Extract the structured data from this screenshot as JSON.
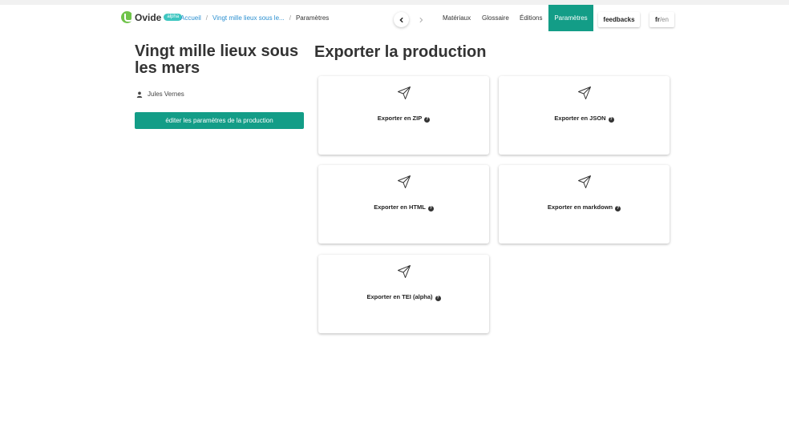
{
  "nav": {
    "logo_text": "Ovide",
    "badge": "alpha",
    "breadcrumb": [
      "Accueil",
      "Vingt mille lieux sous le...",
      "Paramètres"
    ],
    "breadcrumb_sep": "/",
    "menu": [
      "Matériaux",
      "Glossaire",
      "Éditions",
      "Paramètres"
    ],
    "active_menu": "Paramètres",
    "feedbacks": "feedbacks",
    "lang_current": "fr",
    "lang_sep": "/",
    "lang_other": "en"
  },
  "production": {
    "title": "Vingt mille lieux sous les mers",
    "author": "Jules Vernes",
    "edit_button": "éditer les paramètres de la production"
  },
  "export": {
    "heading": "Exporter la production",
    "cards": [
      {
        "label": "Exporter en ZIP",
        "icon": "send-icon",
        "help_icon": "question-circle-icon"
      },
      {
        "label": "Exporter en JSON",
        "icon": "send-icon",
        "help_icon": "question-circle-icon"
      },
      {
        "label": "Exporter en HTML",
        "icon": "send-icon",
        "help_icon": "question-circle-icon"
      },
      {
        "label": "Exporter en markdown",
        "icon": "send-icon",
        "help_icon": "question-circle-icon"
      },
      {
        "label": "Exporter en TEI (alpha)",
        "icon": "send-icon",
        "help_icon": "question-circle-icon"
      }
    ]
  },
  "colors": {
    "accent": "#139d87",
    "link": "#2a8fd0",
    "logo": "#6fc34a"
  }
}
